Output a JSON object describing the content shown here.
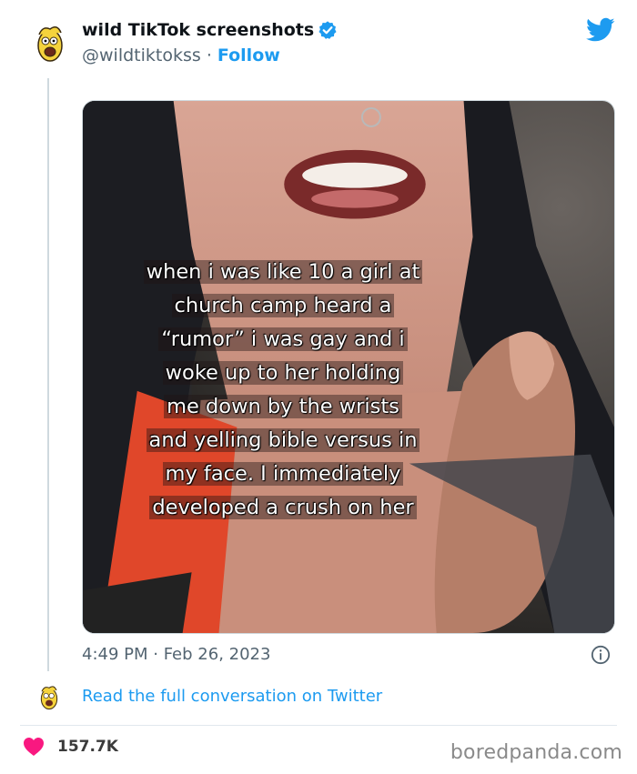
{
  "tweet": {
    "author_name": "wild TikTok screenshots",
    "handle": "@wildtiktokss",
    "separator": "·",
    "follow_label": "Follow",
    "image_caption_lines": [
      "when i was like 10 a girl at",
      "church camp heard a",
      "“rumor” i was gay and i",
      "woke up to her holding",
      "me down by the wrists",
      "and yelling bible versus in",
      "my face. I immediately",
      "developed a crush on her"
    ],
    "timestamp": "4:49 PM · Feb 26, 2023",
    "read_link": "Read the full conversation on Twitter",
    "likes": "157.7K"
  },
  "watermark": "boredpanda.com",
  "colors": {
    "twitter_blue": "#1d9bf0",
    "heart_red": "#f91880",
    "text_secondary": "#536471"
  },
  "icons": {
    "avatar": "cartoon-character-icon",
    "verified": "verified-badge-icon",
    "logo": "twitter-bird-icon",
    "info": "info-icon",
    "like": "heart-icon"
  }
}
